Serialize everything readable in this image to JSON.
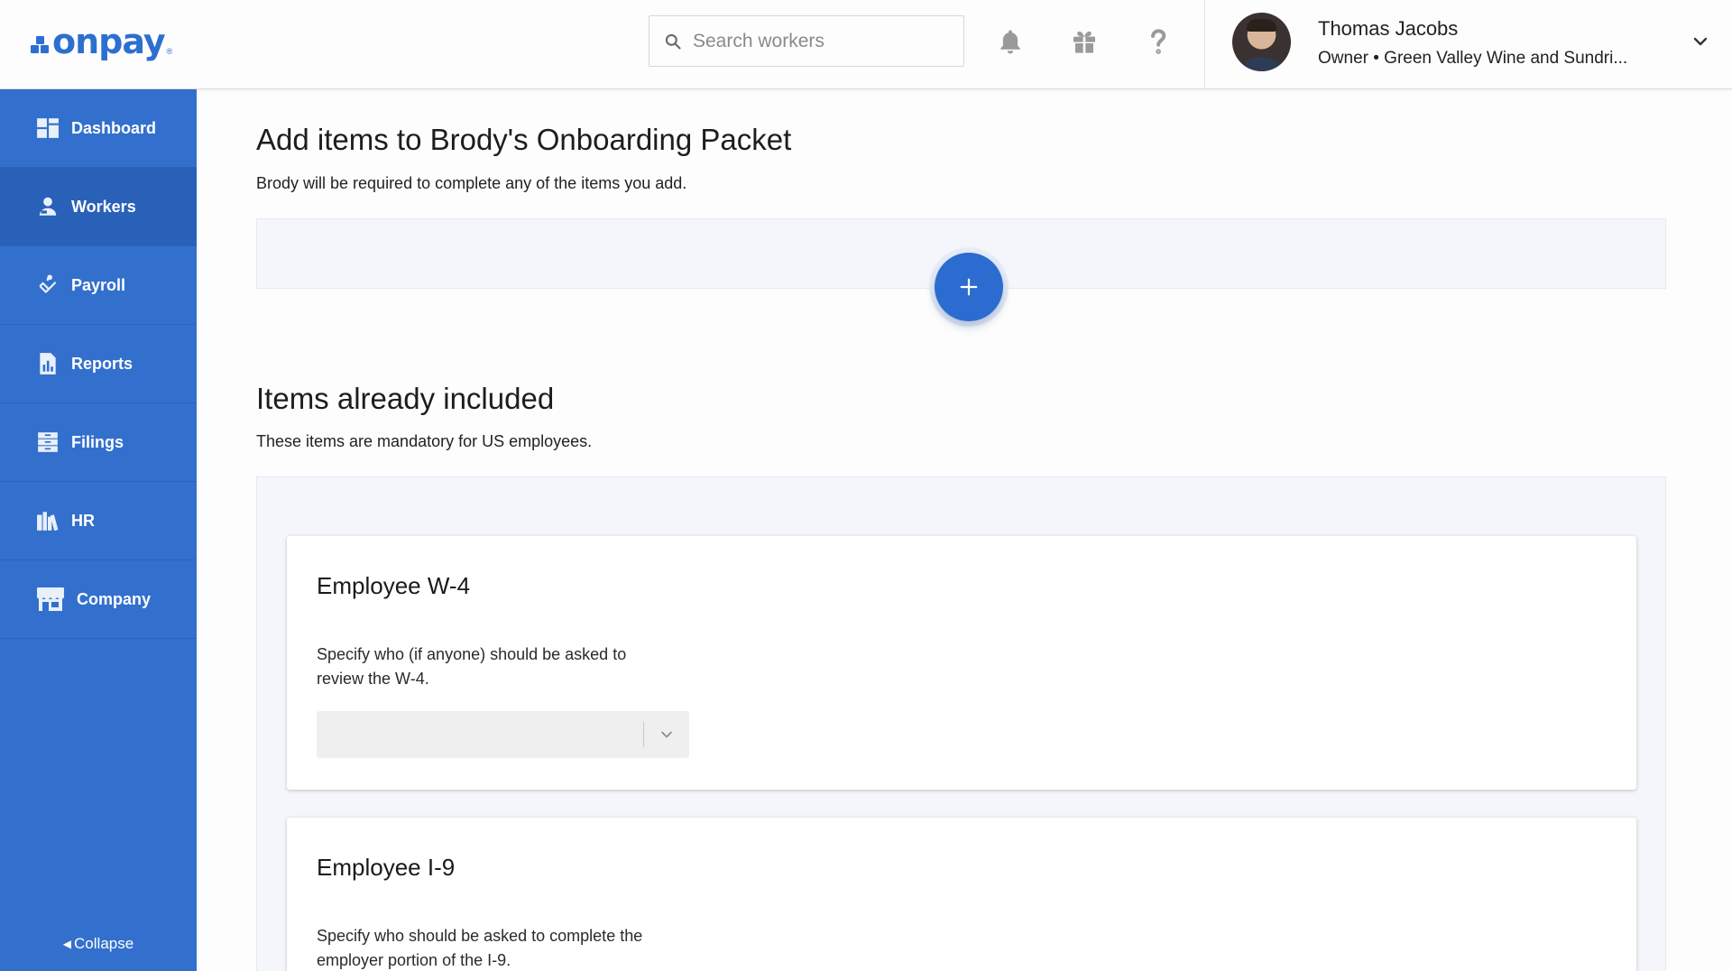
{
  "brand": {
    "logo_text": "onpay",
    "logo_mark": "®",
    "color": "#2d6fd1"
  },
  "header": {
    "search_placeholder": "Search workers",
    "icons": [
      "bell-icon",
      "gift-icon",
      "help-icon"
    ],
    "user": {
      "name": "Thomas Jacobs",
      "role": "Owner • Green Valley Wine and Sundri..."
    }
  },
  "sidebar": {
    "color": "#3370cd",
    "items": [
      {
        "label": "Dashboard",
        "icon": "dashboard-icon",
        "active": false
      },
      {
        "label": "Workers",
        "icon": "workers-icon",
        "active": true
      },
      {
        "label": "Payroll",
        "icon": "payroll-icon",
        "active": false
      },
      {
        "label": "Reports",
        "icon": "reports-icon",
        "active": false
      },
      {
        "label": "Filings",
        "icon": "filings-icon",
        "active": false
      },
      {
        "label": "HR",
        "icon": "hr-icon",
        "active": false
      },
      {
        "label": "Company",
        "icon": "company-icon",
        "active": false
      }
    ],
    "collapse_label": "Collapse"
  },
  "main": {
    "add_title": "Add items to Brody's Onboarding Packet",
    "add_subtitle": "Brody will be required to complete any of the items you add.",
    "included_title": "Items already included",
    "included_subtitle": "These items are mandatory for US employees.",
    "cards": [
      {
        "title": "Employee W-4",
        "description": "Specify who (if anyone) should be asked to review the W-4.",
        "select_value": ""
      },
      {
        "title": "Employee I-9",
        "description": "Specify who should be asked to complete the employer portion of the I-9."
      }
    ]
  }
}
